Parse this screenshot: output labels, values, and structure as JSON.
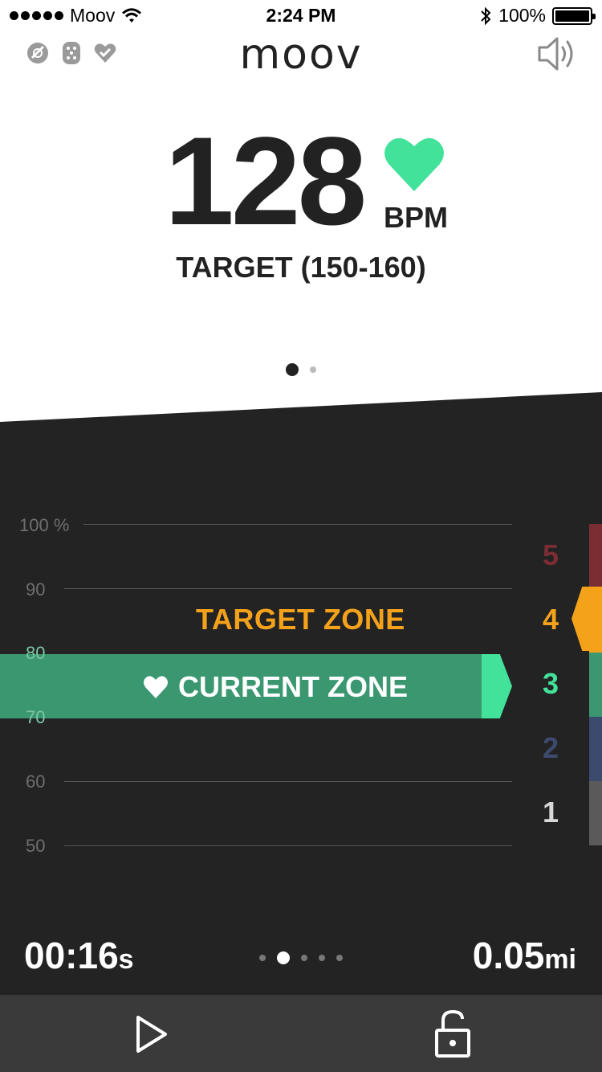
{
  "status_bar": {
    "carrier": "Moov",
    "time": "2:24 PM",
    "battery": "100%",
    "signal_bars": 5,
    "icons": [
      "signal-icon",
      "wifi-icon",
      "bluetooth-icon",
      "battery-icon"
    ]
  },
  "header": {
    "logo": "moov",
    "left_icons": [
      "sensor-icon",
      "pod-icon",
      "heart-check-icon"
    ],
    "right_icon": "speaker-icon"
  },
  "heart_rate": {
    "value": "128",
    "unit": "BPM",
    "target": "TARGET (150-160)"
  },
  "pager_top": {
    "count": 2,
    "active": 0
  },
  "chart": {
    "axis_labels": [
      "100 %",
      "90",
      "80",
      "70",
      "60",
      "50"
    ],
    "target_zone_label": "TARGET ZONE",
    "current_zone_label": "CURRENT ZONE",
    "zones": [
      "5",
      "4",
      "3",
      "2",
      "1"
    ],
    "target_zone": "4",
    "current_zone": "3",
    "zone_colors": {
      "5": "#7a2e34",
      "4": "#f5a21b",
      "3": "#3a9770",
      "2": "#3c4a6e",
      "1": "#5a5a5a"
    },
    "zone_number_colors": {
      "5": "#7a2e34",
      "4": "#f5a21b",
      "3": "#43e29a",
      "2": "#3c4a6e",
      "1": "#d8d8d8"
    }
  },
  "stats": {
    "time_value": "00:16",
    "time_unit": "s",
    "distance_value": "0.05",
    "distance_unit": "mi"
  },
  "pager_bottom": {
    "count": 5,
    "active": 1
  },
  "toolbar": {
    "left_icon": "play-icon",
    "right_icon": "unlock-icon"
  },
  "colors": {
    "accent_green": "#43e29a",
    "target_orange": "#f5a21b",
    "panel": "#232323",
    "toolbar": "#3a3a3a"
  }
}
